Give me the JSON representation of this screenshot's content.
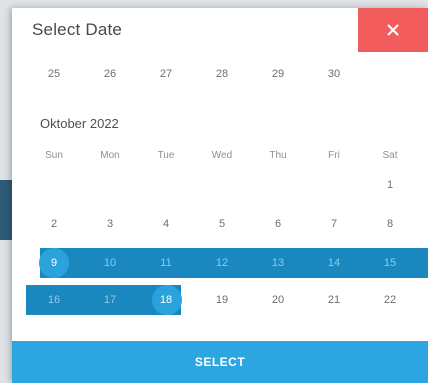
{
  "dialog": {
    "title": "Select Date",
    "close_label": "×",
    "select_label": "SELECT"
  },
  "prev_month_days": [
    "25",
    "26",
    "27",
    "28",
    "29",
    "30"
  ],
  "month": {
    "label": "Oktober 2022",
    "weekdays": [
      "Sun",
      "Mon",
      "Tue",
      "Wed",
      "Thu",
      "Fri",
      "Sat"
    ],
    "weeks": [
      [
        "",
        "",
        "",
        "",
        "",
        "",
        "1"
      ],
      [
        "2",
        "3",
        "4",
        "5",
        "6",
        "7",
        "8"
      ],
      [
        "9",
        "10",
        "11",
        "12",
        "13",
        "14",
        "15"
      ],
      [
        "16",
        "17",
        "18",
        "19",
        "20",
        "21",
        "22"
      ]
    ]
  },
  "selection": {
    "start": "9",
    "end": "18"
  },
  "colors": {
    "accent": "#2ca5e0",
    "range": "#1a88bf",
    "close": "#f25c5c"
  }
}
